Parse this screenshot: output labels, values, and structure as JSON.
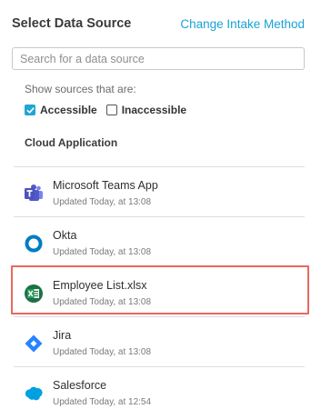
{
  "header": {
    "title": "Select Data Source",
    "change_link": "Change Intake Method"
  },
  "search": {
    "placeholder": "Search for a data source",
    "value": ""
  },
  "filters": {
    "label": "Show sources that are:",
    "accessible": {
      "label": "Accessible",
      "checked": true
    },
    "inaccessible": {
      "label": "Inaccessible",
      "checked": false
    }
  },
  "section": {
    "label": "Cloud Application"
  },
  "sources": [
    {
      "name": "Microsoft Teams App",
      "updated": "Updated Today, at 13:08",
      "icon": "teams-icon"
    },
    {
      "name": "Okta",
      "updated": "Updated Today, at 13:08",
      "icon": "okta-icon"
    },
    {
      "name": "Employee List.xlsx",
      "updated": "Updated Today, at 13:08",
      "icon": "excel-icon"
    },
    {
      "name": "Jira",
      "updated": "Updated Today, at 13:08",
      "icon": "jira-icon"
    },
    {
      "name": "Salesforce",
      "updated": "Updated Today, at 12:54",
      "icon": "salesforce-icon"
    }
  ],
  "colors": {
    "accent": "#1fa6d4",
    "link": "#1aa3d6",
    "highlight_border": "#e8695c"
  }
}
